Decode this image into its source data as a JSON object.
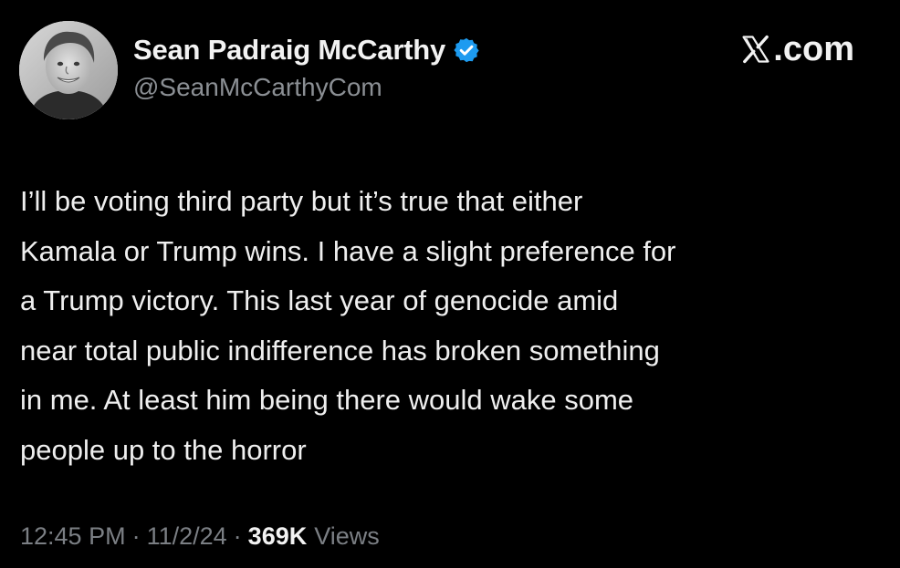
{
  "author": {
    "display_name": "Sean Padraig McCarthy",
    "handle": "@SeanMcCarthyCom",
    "verified": true,
    "verified_color": "#1d9bf0"
  },
  "brand": {
    "icon": "x-logo-icon",
    "suffix": ".com"
  },
  "tweet": {
    "lines": [
      "I’ll be voting third party but it’s true that either",
      "Kamala or Trump wins. I have a slight preference for",
      "a Trump victory. This last year of genocide amid",
      "near total public indifference has broken something",
      "in me. At least him being there would wake some",
      "people up to the horror"
    ]
  },
  "meta": {
    "time": "12:45 PM",
    "separator": "·",
    "date": "11/2/24",
    "views_count": "369K",
    "views_label": "Views"
  },
  "colors": {
    "background": "#000000",
    "text": "#efefef",
    "muted": "#7b7f84"
  }
}
